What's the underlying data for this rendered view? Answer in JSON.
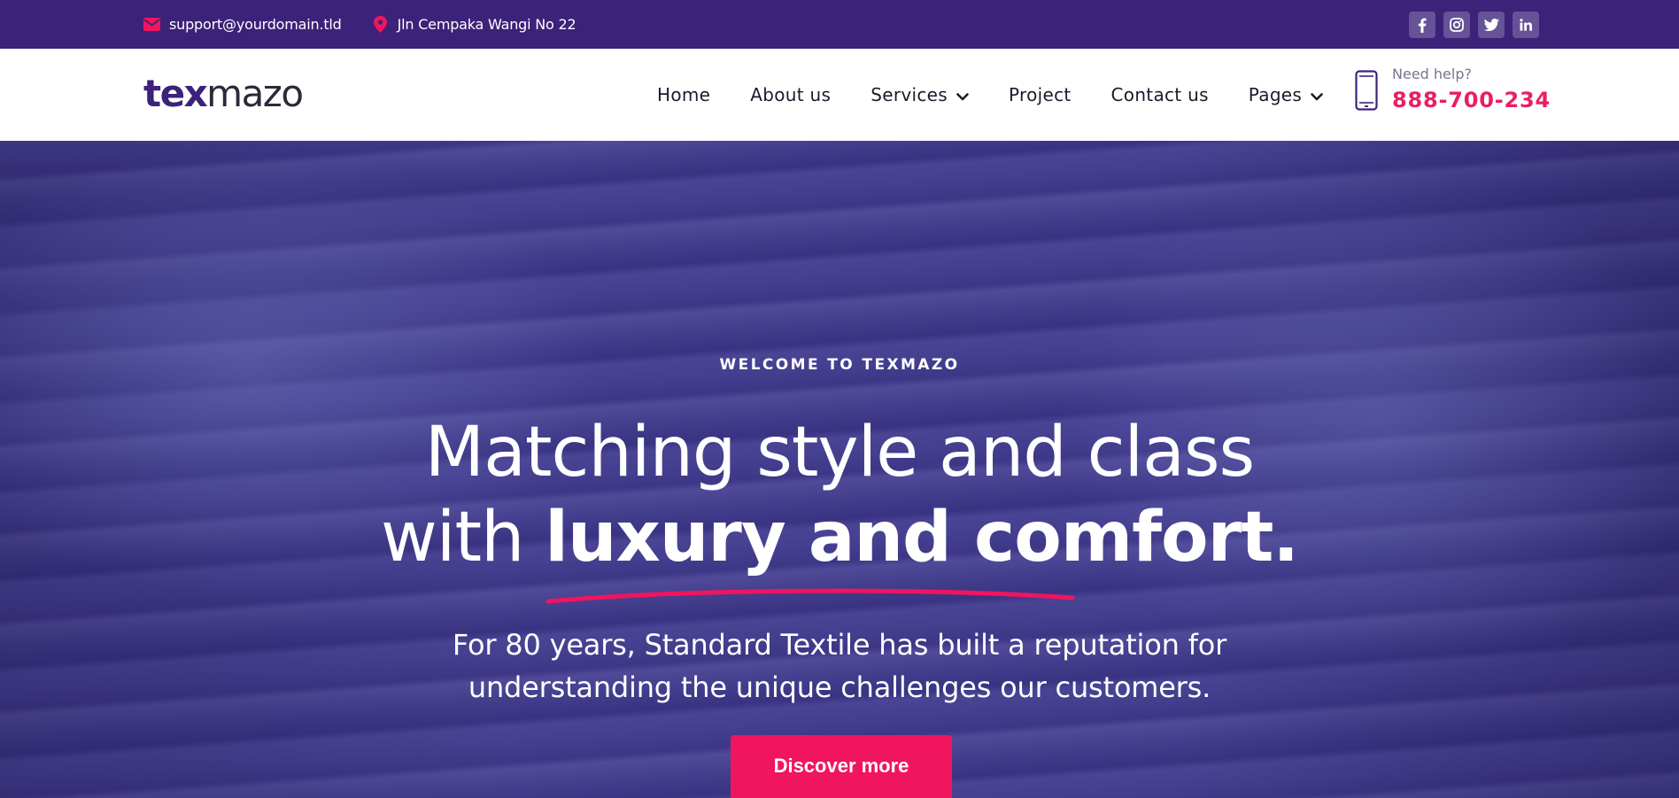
{
  "topbar": {
    "email": "support@yourdomain.tld",
    "address": "Jln Cempaka Wangi No 22",
    "socials": [
      "facebook-icon",
      "instagram-icon",
      "twitter-icon",
      "linkedin-icon"
    ]
  },
  "header": {
    "logo_part1": "tex",
    "logo_part2": "mazo",
    "nav": [
      {
        "label": "Home",
        "dropdown": false
      },
      {
        "label": "About us",
        "dropdown": false
      },
      {
        "label": "Services",
        "dropdown": true
      },
      {
        "label": "Project",
        "dropdown": false
      },
      {
        "label": "Contact us",
        "dropdown": false
      },
      {
        "label": "Pages",
        "dropdown": true
      }
    ],
    "help_label": "Need help?",
    "help_phone": "888-700-234"
  },
  "hero": {
    "eyebrow": "WELCOME TO TEXMAZO",
    "headline_line1": "Matching style and class",
    "headline_line2_prefix": "with ",
    "headline_line2_emphasis": "luxury and comfort.",
    "subtext_line1": "For 80 years, Standard Textile has built a reputation for",
    "subtext_line2": "understanding the unique challenges our customers.",
    "cta_label": "Discover more"
  },
  "colors": {
    "topbar_bg": "#3c2279",
    "brand_purple": "#3c2279",
    "accent_pink": "#f0155e",
    "phone_pink": "#e8205f"
  }
}
